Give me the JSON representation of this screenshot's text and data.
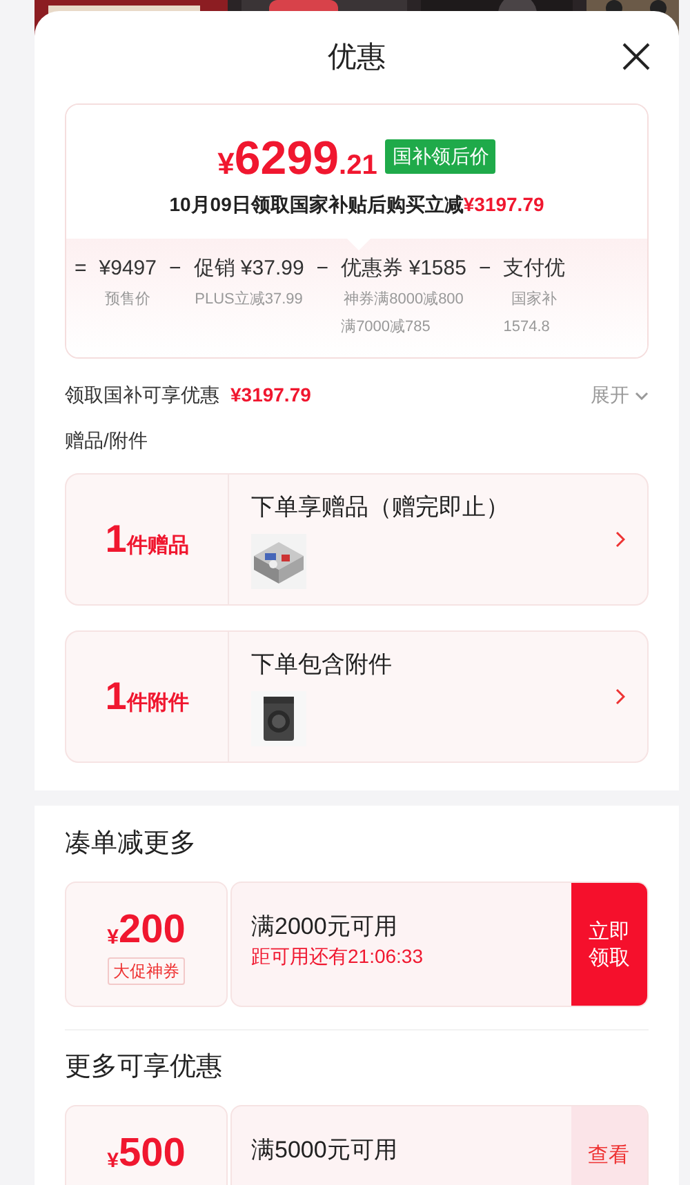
{
  "sheet": {
    "title": "优惠"
  },
  "price_card": {
    "currency": "¥",
    "price_int": "6299",
    "price_dec": ".21",
    "badge": "国补领后价",
    "note": "10月09日领取国家补贴后购买立减",
    "note_amount": "¥3197.79",
    "breakdown": [
      {
        "kind": "operator",
        "text": "="
      },
      {
        "kind": "item",
        "value": "¥9497",
        "details": [
          "预售价"
        ]
      },
      {
        "kind": "operator",
        "text": "−"
      },
      {
        "kind": "item",
        "label": "促销",
        "value": "¥37.99",
        "details": [
          "PLUS立减37.99"
        ]
      },
      {
        "kind": "operator",
        "text": "−"
      },
      {
        "kind": "item",
        "label": "优惠券",
        "value": "¥1585",
        "details": [
          "神券满8000减800",
          "满7000减785"
        ]
      },
      {
        "kind": "operator",
        "text": "−"
      },
      {
        "kind": "item",
        "label": "支付优",
        "details": [
          "国家补",
          "1574.8"
        ]
      }
    ]
  },
  "subsidy": {
    "label": "领取国补可享优惠",
    "amount": "¥3197.79",
    "toggle": "展开"
  },
  "gifts": {
    "title": "赠品/附件",
    "items": [
      {
        "count": "1",
        "unit": "件赠品",
        "title": "下单享赠品（赠完即止）",
        "kind": "room"
      },
      {
        "count": "1",
        "unit": "件附件",
        "title": "下单包含附件",
        "kind": "washer"
      }
    ]
  },
  "sections": [
    {
      "title": "凑单减更多",
      "coupons": [
        {
          "kind": "claim",
          "currency": "¥",
          "amount": "200",
          "tag": "大促神券",
          "condition": "满2000元可用",
          "countdown": "距可用还有21:06:33",
          "action": "立即领取"
        }
      ]
    },
    {
      "title": "更多可享优惠",
      "coupons": [
        {
          "kind": "details",
          "currency": "¥",
          "amount": "500",
          "condition": "满5000元可用",
          "action": "查看"
        }
      ]
    }
  ]
}
